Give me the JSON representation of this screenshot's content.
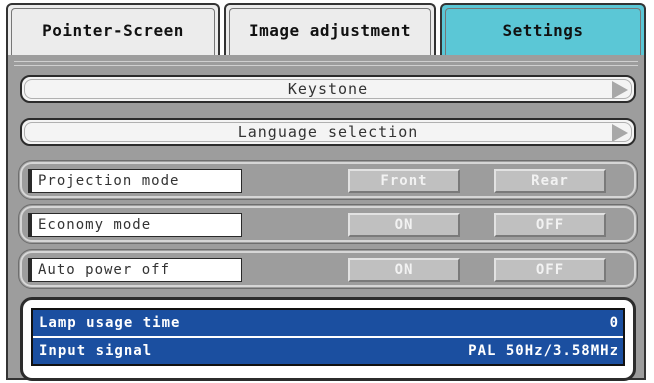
{
  "tabs": [
    {
      "label": "Pointer-Screen",
      "active": false
    },
    {
      "label": "Image adjustment",
      "active": false
    },
    {
      "label": "Settings",
      "active": true
    }
  ],
  "menu": {
    "keystone": "Keystone",
    "language": "Language selection"
  },
  "options": {
    "projection": {
      "label": "Projection mode",
      "a": "Front",
      "b": "Rear"
    },
    "economy": {
      "label": "Economy mode",
      "a": "ON",
      "b": "OFF"
    },
    "autopower": {
      "label": "Auto power off",
      "a": "ON",
      "b": "OFF"
    }
  },
  "info": {
    "lamp_label": "Lamp usage time",
    "lamp_value": "0",
    "signal_label": "Input signal",
    "signal_value": "PAL 50Hz/3.58MHz"
  },
  "colors": {
    "active_tab": "#5bc7d6",
    "panel": "#9d9d9d",
    "info_bg": "#1b4fa0"
  },
  "icons": {
    "submenu": "right-triangle-arrow"
  }
}
